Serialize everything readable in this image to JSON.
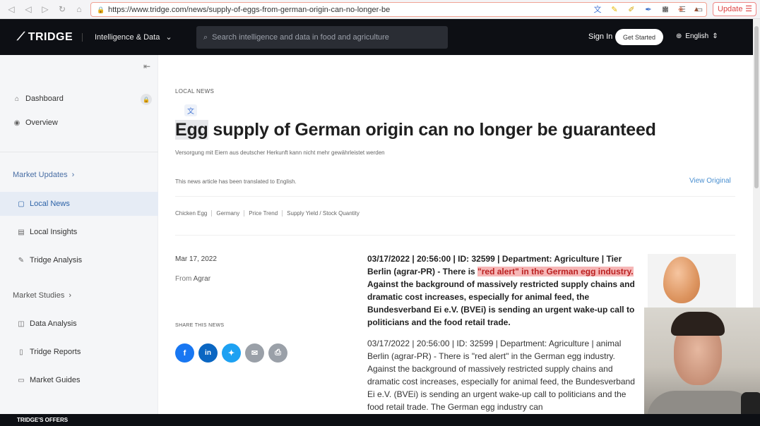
{
  "browser": {
    "url": "https://www.tridge.com/news/supply-of-eggs-from-german-origin-can-no-longer-be",
    "update_label": "Update"
  },
  "header": {
    "logo": "TRIDGE",
    "nav_label": "Intelligence & Data",
    "search_placeholder": "Search intelligence and data in food and agriculture",
    "signin": "Sign In",
    "get_started": "Get Started",
    "language": "English"
  },
  "sidebar": {
    "dashboard": "Dashboard",
    "overview": "Overview",
    "market_updates": "Market Updates",
    "local_news": "Local News",
    "local_insights": "Local Insights",
    "tridge_analysis": "Tridge Analysis",
    "market_studies": "Market Studies",
    "data_analysis": "Data Analysis",
    "tridge_reports": "Tridge Reports",
    "market_guides": "Market Guides"
  },
  "article": {
    "category": "LOCAL NEWS",
    "title_highlight": "Egg",
    "title_rest": " supply of German origin can no longer be guaranteed",
    "original_title": "Versorgung mit Eiern aus deutscher Herkunft kann nicht mehr gewährleistet werden",
    "translated_note": "This news article has been translated to English.",
    "view_original": "View Original",
    "tags": [
      "Chicken Egg",
      "Germany",
      "Price Trend",
      "Supply Yield / Stock Quantity"
    ],
    "date": "Mar 17, 2022",
    "from_label": "From",
    "from_source": "Agrar",
    "share_label": "SHARE THIS NEWS",
    "lead_pre": "03/17/2022 | 20:56:00 | ID: 32599 | Department: Agriculture | Tier Berlin (agrar-PR) - There is ",
    "lead_mark": "\"red alert\" in the German egg industry.",
    "lead_post": " Against the background of massively restricted supply chains and dramatic cost increases, especially for animal feed, the Bundesverband Ei e.V. (BVEi) is sending an urgent wake-up call to politicians and the food retail trade.",
    "body": "03/17/2022 | 20:56:00 | ID: 32599 | Department: Agriculture | animal Berlin (agrar-PR) - There is \"red alert\" in the German egg industry. Against the background of massively restricted supply chains and dramatic cost increases, especially for animal feed, the Bundesverband Ei e.V. (BVEi) is sending an urgent wake-up call to politicians and the food retail trade. The German egg industry can"
  },
  "ticker": {
    "label": "TRIDGE'S OFFERS"
  },
  "colors": {
    "header_bg": "#0d0f14",
    "link": "#4a8fd0",
    "highlight": "#f6b7b7",
    "facebook": "#1877f2",
    "linkedin": "#0a66c2",
    "twitter": "#1da1f2"
  }
}
